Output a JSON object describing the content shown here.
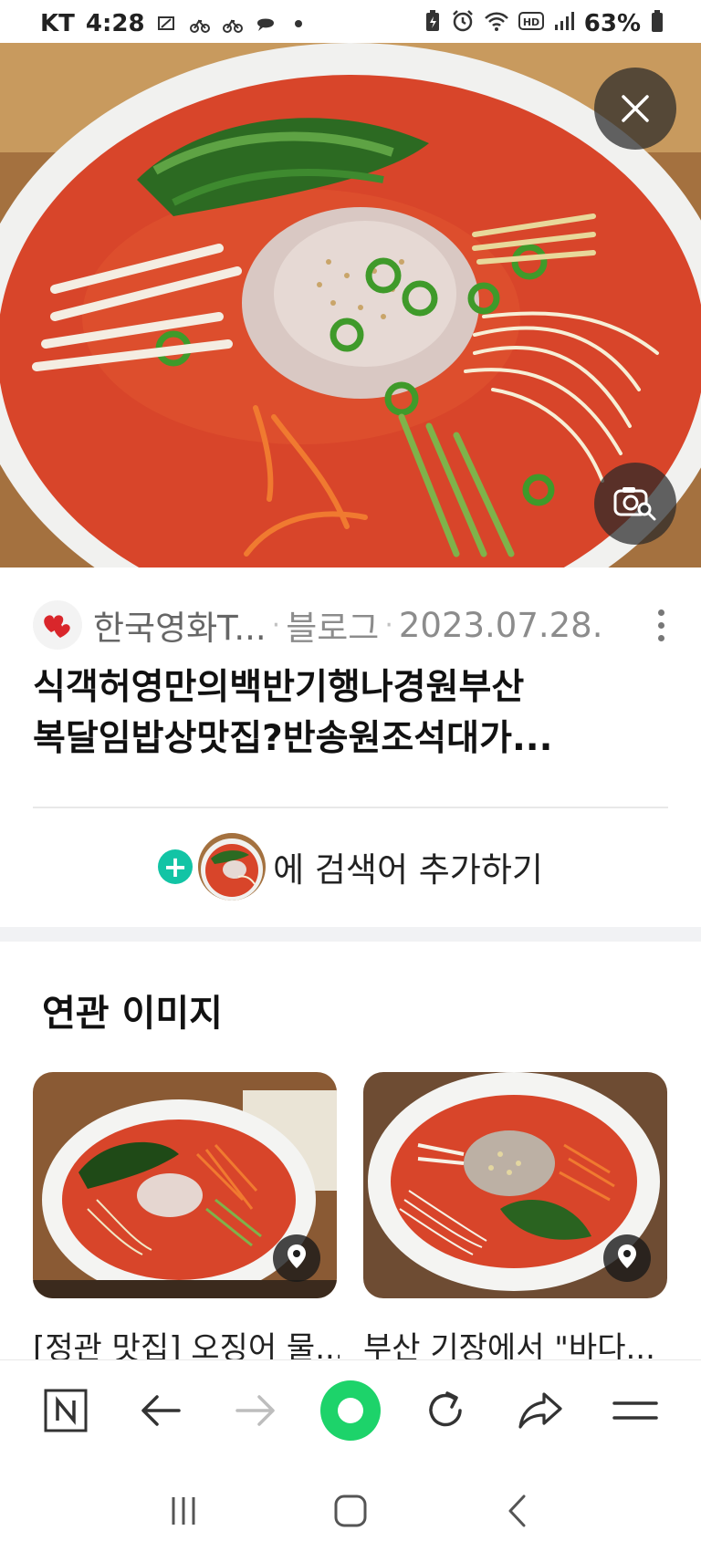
{
  "status_bar": {
    "carrier": "KT",
    "time": "4:28",
    "battery": "63%",
    "left_icons": [
      "screenshot-icon",
      "bike-icon",
      "bike-icon",
      "chat-bubble-icon",
      "dot-icon"
    ],
    "right_icons": [
      "battery-saver-icon",
      "alarm-icon",
      "wifi-icon",
      "hd-icon",
      "signal-icon",
      "battery-icon"
    ]
  },
  "viewer": {
    "close_icon": "close-icon",
    "lens_icon": "image-search-icon"
  },
  "source": {
    "name": "한국영화T...",
    "separator": "·",
    "type": "블로그",
    "date": "2023.07.28."
  },
  "title": {
    "line1": "식객허영만의백반기행나경원부산",
    "line2": "복달임밥상맛집?반송원조석대가..."
  },
  "add_search": {
    "plus": "+",
    "label": "에 검색어 추가하기"
  },
  "related": {
    "heading": "연관 이미지",
    "items": [
      {
        "caption": "[정관 맛집] 오징어 물..."
      },
      {
        "caption": "부산 기장에서 \"바다..."
      }
    ]
  },
  "toolbar": {
    "items": [
      "naver-home-icon",
      "back-icon",
      "forward-icon",
      "green-dot-icon",
      "refresh-icon",
      "share-icon",
      "menu-icon"
    ]
  },
  "navbar": {
    "items": [
      "recent-apps-icon",
      "home-icon",
      "back-nav-icon"
    ]
  },
  "colors": {
    "accent": "#12c4a5",
    "green_button": "#1dd36a",
    "broth": "#d8452a"
  }
}
